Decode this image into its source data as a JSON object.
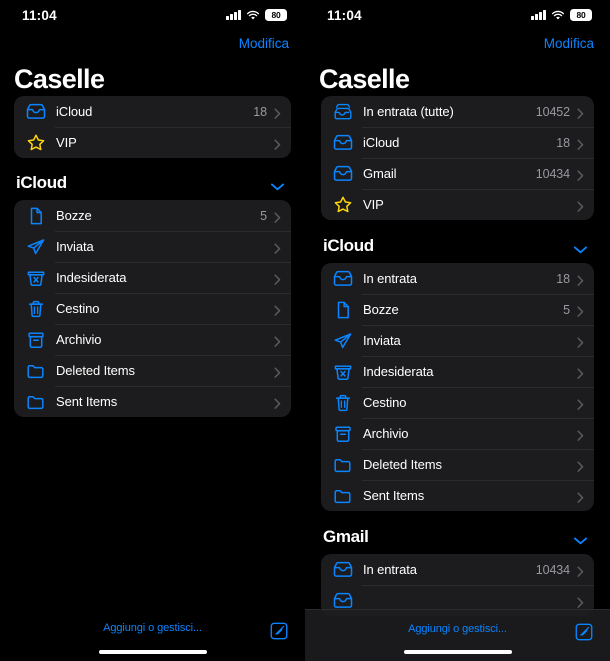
{
  "colors": {
    "accent": "#0a84ff",
    "star": "#ffd60a",
    "background": "#000000",
    "row_background": "#1c1c1e",
    "secondary_text": "#98989f"
  },
  "status_bar": {
    "time": "11:04",
    "battery_level": "80",
    "signal_icon": "cellular-signal-icon",
    "wifi_icon": "wifi-icon",
    "battery_icon": "battery-icon"
  },
  "nav": {
    "edit_label": "Modifica",
    "title": "Caselle"
  },
  "toolbar": {
    "manage_label": "Aggiungi o gestisci...",
    "compose_icon": "compose-icon"
  },
  "left_panel": {
    "primary_group": [
      {
        "icon": "inbox-tray-icon",
        "label": "iCloud",
        "count": "18"
      },
      {
        "icon": "star-icon",
        "label": "VIP",
        "count": ""
      }
    ],
    "sections": [
      {
        "title": "iCloud",
        "chevron": "chevron-down-icon",
        "items": [
          {
            "icon": "document-icon",
            "label": "Bozze",
            "count": "5"
          },
          {
            "icon": "paper-plane-icon",
            "label": "Inviata",
            "count": ""
          },
          {
            "icon": "junk-bin-icon",
            "label": "Indesiderata",
            "count": ""
          },
          {
            "icon": "trash-icon",
            "label": "Cestino",
            "count": ""
          },
          {
            "icon": "archive-box-icon",
            "label": "Archivio",
            "count": ""
          },
          {
            "icon": "folder-icon",
            "label": "Deleted Items",
            "count": ""
          },
          {
            "icon": "folder-icon",
            "label": "Sent Items",
            "count": ""
          }
        ]
      }
    ]
  },
  "right_panel": {
    "primary_group": [
      {
        "icon": "all-inboxes-icon",
        "label": "In entrata (tutte)",
        "count": "10452"
      },
      {
        "icon": "inbox-tray-icon",
        "label": "iCloud",
        "count": "18"
      },
      {
        "icon": "inbox-tray-icon",
        "label": "Gmail",
        "count": "10434"
      },
      {
        "icon": "star-icon",
        "label": "VIP",
        "count": ""
      }
    ],
    "sections": [
      {
        "title": "iCloud",
        "chevron": "chevron-down-icon",
        "items": [
          {
            "icon": "inbox-tray-icon",
            "label": "In entrata",
            "count": "18"
          },
          {
            "icon": "document-icon",
            "label": "Bozze",
            "count": "5"
          },
          {
            "icon": "paper-plane-icon",
            "label": "Inviata",
            "count": ""
          },
          {
            "icon": "junk-bin-icon",
            "label": "Indesiderata",
            "count": ""
          },
          {
            "icon": "trash-icon",
            "label": "Cestino",
            "count": ""
          },
          {
            "icon": "archive-box-icon",
            "label": "Archivio",
            "count": ""
          },
          {
            "icon": "folder-icon",
            "label": "Deleted Items",
            "count": ""
          },
          {
            "icon": "folder-icon",
            "label": "Sent Items",
            "count": ""
          }
        ]
      },
      {
        "title": "Gmail",
        "chevron": "chevron-down-icon",
        "items": [
          {
            "icon": "inbox-tray-icon",
            "label": "In entrata",
            "count": "10434"
          },
          {
            "icon": "inbox-tray-icon",
            "label": "",
            "count": ""
          }
        ]
      }
    ]
  }
}
